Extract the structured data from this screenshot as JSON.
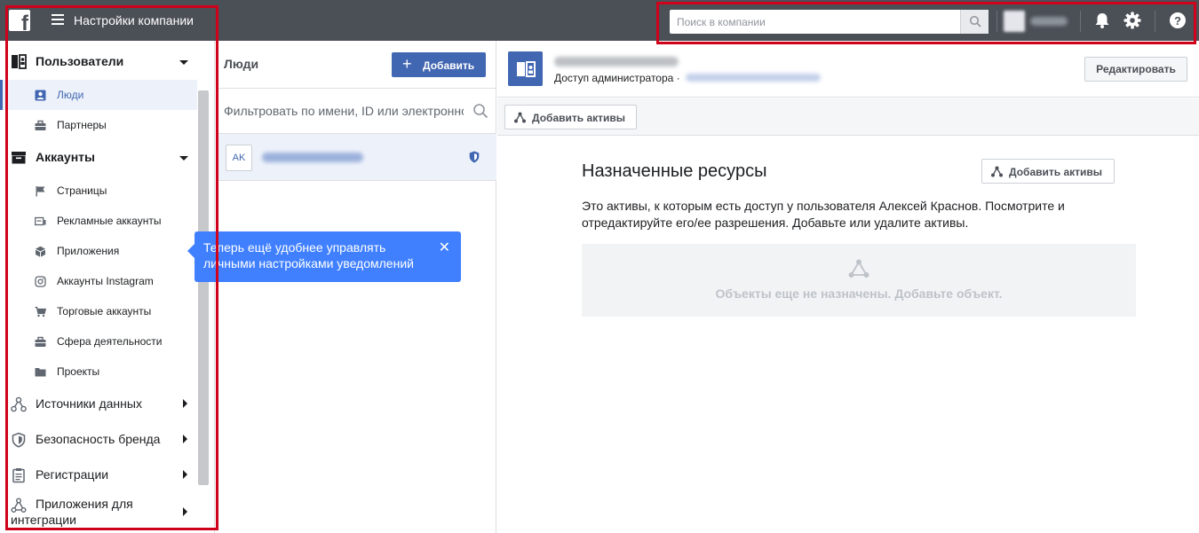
{
  "header": {
    "logo": "f",
    "title": "Настройки компании",
    "search_placeholder": "Поиск в компании"
  },
  "sidebar": {
    "users": {
      "label": "Пользователи"
    },
    "user_items": [
      {
        "label": "Люди"
      },
      {
        "label": "Партнеры"
      }
    ],
    "accounts": {
      "label": "Аккаунты"
    },
    "account_items": [
      {
        "label": "Страницы"
      },
      {
        "label": "Рекламные аккаунты"
      },
      {
        "label": "Приложения"
      },
      {
        "label": "Аккаунты Instagram"
      },
      {
        "label": "Торговые аккаунты"
      },
      {
        "label": "Сфера деятельности"
      },
      {
        "label": "Проекты"
      }
    ],
    "data_sources": {
      "label": "Источники данных"
    },
    "brand_safety": {
      "label": "Безопасность бренда"
    },
    "registrations": {
      "label": "Регистрации"
    },
    "integrations": {
      "label_line1": "Приложения для",
      "label_line2": "интеграции"
    }
  },
  "tooltip": {
    "text": "Теперь ещё удобнее управлять личными настройками уведомлений",
    "close": "✕"
  },
  "people": {
    "title": "Люди",
    "add_label": "Добавить",
    "filter_placeholder": "Фильтровать по имени, ID или электронному адресу",
    "rows": [
      {
        "initials": "AK"
      }
    ]
  },
  "detail": {
    "access_label": "Доступ администратора ·",
    "edit_label": "Редактировать",
    "toolbar_add_assets": "Добавить активы",
    "section_title": "Назначенные ресурсы",
    "section_add_assets": "Добавить активы",
    "description": "Это активы, к которым есть доступ у пользователя Алексей Краснов. Посмотрите и отредактируйте его/ее разрешения. Добавьте или удалите активы.",
    "empty_text": "Объекты еще не назначены. Добавьте объект."
  },
  "colors": {
    "topbar": "#4b4f56",
    "brand_blue": "#4267b2",
    "tooltip_blue": "#4080ff",
    "highlight_red": "#d0021b"
  }
}
